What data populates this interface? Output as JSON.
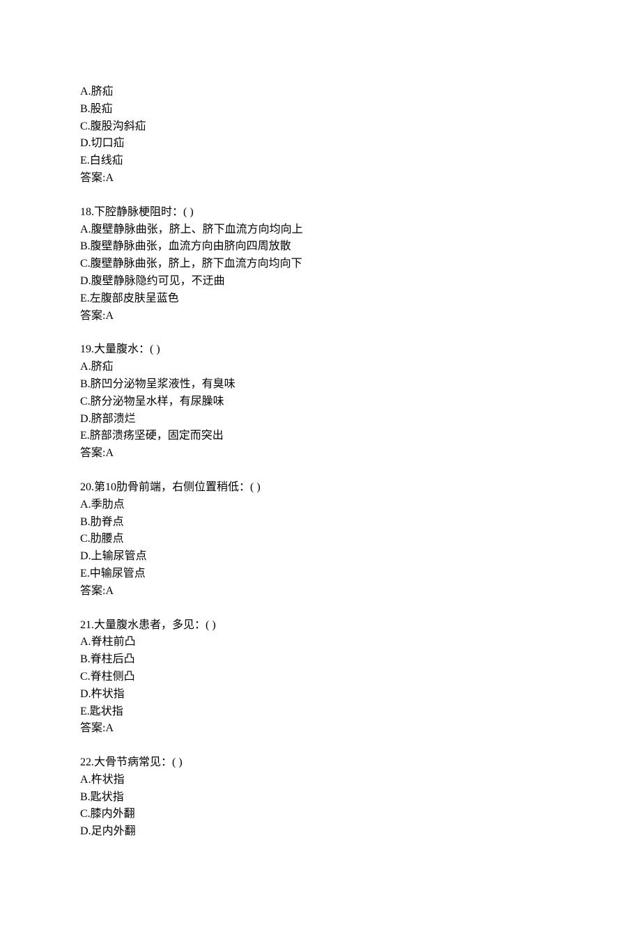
{
  "questions": [
    {
      "number": "",
      "stem": "",
      "options": [
        {
          "letter": "A",
          "text": "脐疝"
        },
        {
          "letter": "B",
          "text": "股疝"
        },
        {
          "letter": "C",
          "text": "腹股沟斜疝"
        },
        {
          "letter": "D",
          "text": "切口疝"
        },
        {
          "letter": "E",
          "text": "白线疝"
        }
      ],
      "answer_label": "答案:",
      "answer_value": "A"
    },
    {
      "number": "18.",
      "stem": "下腔静脉梗阻时：( )",
      "options": [
        {
          "letter": "A",
          "text": "腹壁静脉曲张，脐上、脐下血流方向均向上"
        },
        {
          "letter": "B",
          "text": "腹壁静脉曲张，血流方向由脐向四周放散"
        },
        {
          "letter": "C",
          "text": "腹壁静脉曲张，脐上，脐下血流方向均向下"
        },
        {
          "letter": "D",
          "text": "腹壁静脉隐约可见，不迂曲"
        },
        {
          "letter": "E",
          "text": "左腹部皮肤呈蓝色"
        }
      ],
      "answer_label": "答案:",
      "answer_value": "A"
    },
    {
      "number": "19.",
      "stem": "大量腹水：( )",
      "options": [
        {
          "letter": "A",
          "text": "脐疝"
        },
        {
          "letter": "B",
          "text": "脐凹分泌物呈浆液性，有臭味"
        },
        {
          "letter": "C",
          "text": "脐分泌物呈水样，有尿臊味"
        },
        {
          "letter": "D",
          "text": "脐部溃烂"
        },
        {
          "letter": "E",
          "text": "脐部溃疡坚硬，固定而突出"
        }
      ],
      "answer_label": "答案:",
      "answer_value": "A"
    },
    {
      "number": "20.",
      "stem": "第10肋骨前端，右侧位置稍低：( )",
      "options": [
        {
          "letter": "A",
          "text": "季肋点"
        },
        {
          "letter": "B",
          "text": "肋脊点"
        },
        {
          "letter": "C",
          "text": "肋腰点"
        },
        {
          "letter": "D",
          "text": "上输尿管点"
        },
        {
          "letter": "E",
          "text": "中输尿管点"
        }
      ],
      "answer_label": "答案:",
      "answer_value": "A"
    },
    {
      "number": "21.",
      "stem": "大量腹水患者，多见：( )",
      "options": [
        {
          "letter": "A",
          "text": "脊柱前凸"
        },
        {
          "letter": "B",
          "text": "脊柱后凸"
        },
        {
          "letter": "C",
          "text": "脊柱侧凸"
        },
        {
          "letter": "D",
          "text": "杵状指"
        },
        {
          "letter": "E",
          "text": "匙状指"
        }
      ],
      "answer_label": "答案:",
      "answer_value": "A"
    },
    {
      "number": "22.",
      "stem": "大骨节病常见：( )",
      "options": [
        {
          "letter": "A",
          "text": "杵状指"
        },
        {
          "letter": "B",
          "text": "匙状指"
        },
        {
          "letter": "C",
          "text": "膝内外翻"
        },
        {
          "letter": "D",
          "text": "足内外翻"
        }
      ],
      "answer_label": "",
      "answer_value": ""
    }
  ]
}
